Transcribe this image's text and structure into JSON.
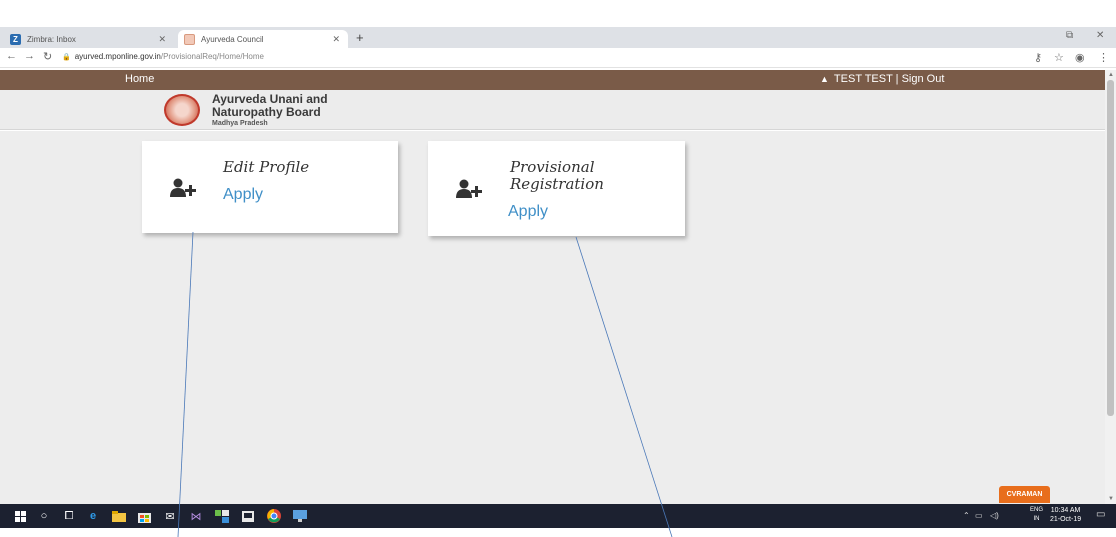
{
  "browser": {
    "tabs": [
      {
        "label": "Zimbra: Inbox",
        "icon": "zimbra-icon"
      },
      {
        "label": "Ayurveda Council",
        "icon": "favicon-icon"
      }
    ],
    "new_tab": "+",
    "url_host": "ayurved.mponline.gov.in",
    "url_path": "/ProvisionalReq/Home/Home"
  },
  "site_nav": {
    "home": "Home",
    "user": "TEST TEST | Sign Out"
  },
  "header": {
    "line1": "Ayurveda Unani and",
    "line2": "Naturopathy Board",
    "line3": "Madhya Pradesh"
  },
  "cards": [
    {
      "title": "Edit Profile",
      "action": "Apply"
    },
    {
      "title_line1": "Provisional",
      "title_line2": "Registration",
      "action": "Apply"
    }
  ],
  "user_badge": "CVRAMAN",
  "taskbar": {
    "lang1": "ENG",
    "lang2": "IN",
    "time": "10:34 AM",
    "date": "21-Oct-19"
  },
  "colors": {
    "nav_brown": "#7a5b48",
    "link_blue": "#3f8fc7",
    "badge_orange": "#e86e1c",
    "taskbar": "#1c2130"
  }
}
